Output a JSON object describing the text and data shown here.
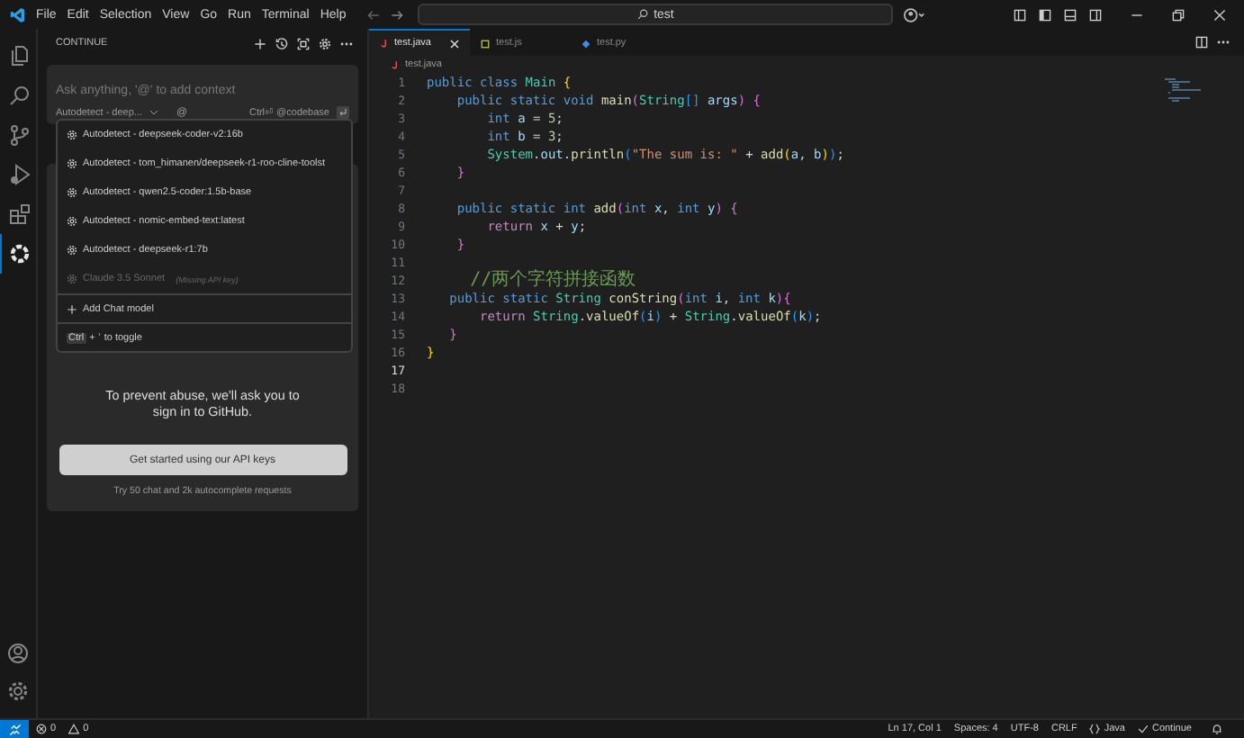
{
  "title_bar": {
    "menus": [
      "File",
      "Edit",
      "Selection",
      "View",
      "Go",
      "Run",
      "Terminal",
      "Help"
    ],
    "search": {
      "value": "test"
    }
  },
  "activity_bar": {
    "items": [
      {
        "kind": "files",
        "selected": false
      },
      {
        "kind": "search",
        "selected": false
      },
      {
        "kind": "source-control",
        "selected": false
      },
      {
        "kind": "run",
        "selected": false
      },
      {
        "kind": "extensions",
        "selected": false
      },
      {
        "kind": "continue",
        "selected": true
      }
    ]
  },
  "sidebar": {
    "title": "CONTINUE",
    "chat_input": {
      "placeholder": "Ask anything, '@' to add context",
      "model": "Autodetect - deep...",
      "at": "@",
      "shortcut": "Ctrl⏎ @codebase"
    },
    "model_menu": {
      "items": [
        {
          "kind": "model",
          "label": "Autodetect - deepseek-coder-v2:16b",
          "disabled": false
        },
        {
          "kind": "model",
          "label": "Autodetect - tom_himanen/deepseek-r1-roo-cline-toolst",
          "disabled": false
        },
        {
          "kind": "model",
          "label": "Autodetect - qwen2.5-coder:1.5b-base",
          "disabled": false
        },
        {
          "kind": "model",
          "label": "Autodetect - nomic-embed-text:latest",
          "disabled": false
        },
        {
          "kind": "model",
          "label": "Autodetect - deepseek-r1:7b",
          "disabled": false
        },
        {
          "kind": "model",
          "label": "Claude 3.5 Sonnet",
          "note": "(Missing API key)",
          "disabled": true
        }
      ],
      "add_label": "Add Chat model",
      "toggle_keys": [
        "Ctrl",
        "'"
      ],
      "toggle_plus": "+",
      "toggle_text": "to toggle"
    },
    "sign_in": {
      "message": "To prevent abuse, we'll ask you to sign in to GitHub.",
      "button": "Get started using our API keys",
      "hint": "Try 50 chat and 2k autocomplete requests"
    }
  },
  "editor": {
    "tabs": [
      {
        "label": "test.java",
        "kind": "java",
        "selected": true
      },
      {
        "label": "test.js",
        "kind": "js",
        "selected": false
      },
      {
        "label": "test.py",
        "kind": "py",
        "selected": false
      }
    ],
    "breadcrumb": "test.java",
    "lines": [
      {
        "number": "1",
        "active": false,
        "tokens": [
          {
            "kind": "keyword",
            "text": "public class "
          },
          {
            "kind": "type",
            "text": "Main "
          },
          {
            "kind": "bracket",
            "text": "{"
          }
        ]
      },
      {
        "number": "2",
        "active": false,
        "tokens": [
          {
            "kind": "keyword",
            "text": "    public static void "
          },
          {
            "kind": "function",
            "text": "main"
          },
          {
            "kind": "bracket2",
            "text": "("
          },
          {
            "kind": "type",
            "text": "String"
          },
          {
            "kind": "bracket3",
            "text": "[]"
          },
          {
            "kind": "variable",
            "text": " args"
          },
          {
            "kind": "bracket2",
            "text": ")"
          },
          {
            "kind": "bracket2",
            "text": " {"
          }
        ]
      },
      {
        "number": "3",
        "active": false,
        "tokens": [
          {
            "kind": "keyword",
            "text": "        int "
          },
          {
            "kind": "variable",
            "text": "a"
          },
          {
            "kind": "plain",
            "text": " = "
          },
          {
            "kind": "number",
            "text": "5"
          },
          {
            "kind": "plain",
            "text": ";"
          }
        ]
      },
      {
        "number": "4",
        "active": false,
        "tokens": [
          {
            "kind": "keyword",
            "text": "        int "
          },
          {
            "kind": "variable",
            "text": "b"
          },
          {
            "kind": "plain",
            "text": " = "
          },
          {
            "kind": "number",
            "text": "3"
          },
          {
            "kind": "plain",
            "text": ";"
          }
        ]
      },
      {
        "number": "5",
        "active": false,
        "tokens": [
          {
            "kind": "type",
            "text": "        System"
          },
          {
            "kind": "plain",
            "text": "."
          },
          {
            "kind": "variable",
            "text": "out"
          },
          {
            "kind": "plain",
            "text": "."
          },
          {
            "kind": "function",
            "text": "println"
          },
          {
            "kind": "bracket3",
            "text": "("
          },
          {
            "kind": "string",
            "text": "\"The sum is: \""
          },
          {
            "kind": "plain",
            "text": " + "
          },
          {
            "kind": "function",
            "text": "add"
          },
          {
            "kind": "bracket",
            "text": "("
          },
          {
            "kind": "variable",
            "text": "a, b"
          },
          {
            "kind": "bracket",
            "text": ")"
          },
          {
            "kind": "bracket3",
            "text": ")"
          },
          {
            "kind": "plain",
            "text": ";"
          }
        ]
      },
      {
        "number": "6",
        "active": false,
        "tokens": [
          {
            "kind": "bracket2",
            "text": "    }"
          }
        ]
      },
      {
        "number": "7",
        "active": false
      },
      {
        "number": "8",
        "active": false,
        "tokens": [
          {
            "kind": "keyword",
            "text": "    public static int "
          },
          {
            "kind": "function",
            "text": "add"
          },
          {
            "kind": "bracket2",
            "text": "("
          },
          {
            "kind": "keyword",
            "text": "int "
          },
          {
            "kind": "variable",
            "text": "x"
          },
          {
            "kind": "plain",
            "text": ", "
          },
          {
            "kind": "keyword",
            "text": "int "
          },
          {
            "kind": "variable",
            "text": "y"
          },
          {
            "kind": "bracket2",
            "text": ")"
          },
          {
            "kind": "bracket2",
            "text": " {"
          }
        ]
      },
      {
        "number": "9",
        "active": false,
        "tokens": [
          {
            "kind": "control",
            "text": "        return "
          },
          {
            "kind": "variable",
            "text": "x"
          },
          {
            "kind": "plain",
            "text": " + "
          },
          {
            "kind": "variable",
            "text": "y"
          },
          {
            "kind": "plain",
            "text": ";"
          }
        ]
      },
      {
        "number": "10",
        "active": false,
        "tokens": [
          {
            "kind": "bracket2",
            "text": "    }"
          }
        ]
      },
      {
        "number": "11",
        "active": false
      },
      {
        "number": "12",
        "active": false,
        "tokens": [
          {
            "kind": "comment",
            "text": "    //两个字符拼接函数"
          }
        ]
      },
      {
        "number": "13",
        "active": false,
        "tokens": [
          {
            "kind": "keyword",
            "text": "   public static "
          },
          {
            "kind": "type",
            "text": "String "
          },
          {
            "kind": "function",
            "text": "conString"
          },
          {
            "kind": "bracket2",
            "text": "("
          },
          {
            "kind": "keyword",
            "text": "int "
          },
          {
            "kind": "variable",
            "text": "i"
          },
          {
            "kind": "plain",
            "text": ", "
          },
          {
            "kind": "keyword",
            "text": "int "
          },
          {
            "kind": "variable",
            "text": "k"
          },
          {
            "kind": "bracket2",
            "text": ")"
          },
          {
            "kind": "bracket2",
            "text": "{"
          }
        ]
      },
      {
        "number": "14",
        "active": false,
        "tokens": [
          {
            "kind": "control",
            "text": "       return "
          },
          {
            "kind": "type",
            "text": "String"
          },
          {
            "kind": "plain",
            "text": "."
          },
          {
            "kind": "function",
            "text": "valueOf"
          },
          {
            "kind": "bracket3",
            "text": "("
          },
          {
            "kind": "variable",
            "text": "i"
          },
          {
            "kind": "bracket3",
            "text": ")"
          },
          {
            "kind": "plain",
            "text": " + "
          },
          {
            "kind": "type",
            "text": "String"
          },
          {
            "kind": "plain",
            "text": "."
          },
          {
            "kind": "function",
            "text": "valueOf"
          },
          {
            "kind": "bracket3",
            "text": "("
          },
          {
            "kind": "variable",
            "text": "k"
          },
          {
            "kind": "bracket3",
            "text": ")"
          },
          {
            "kind": "plain",
            "text": ";"
          }
        ]
      },
      {
        "number": "15",
        "active": false,
        "tokens": [
          {
            "kind": "bracket2",
            "text": "   }"
          }
        ]
      },
      {
        "number": "16",
        "active": false,
        "tokens": [
          {
            "kind": "bracket",
            "text": "}"
          }
        ]
      },
      {
        "number": "17",
        "active": true
      },
      {
        "number": "18",
        "active": false
      }
    ]
  },
  "status_bar": {
    "errors": "0",
    "warnings": "0",
    "position": "Ln 17, Col 1",
    "spaces": "Spaces: 4",
    "encoding": "UTF-8",
    "eol": "CRLF",
    "language": "Java",
    "continue": "Continue"
  }
}
